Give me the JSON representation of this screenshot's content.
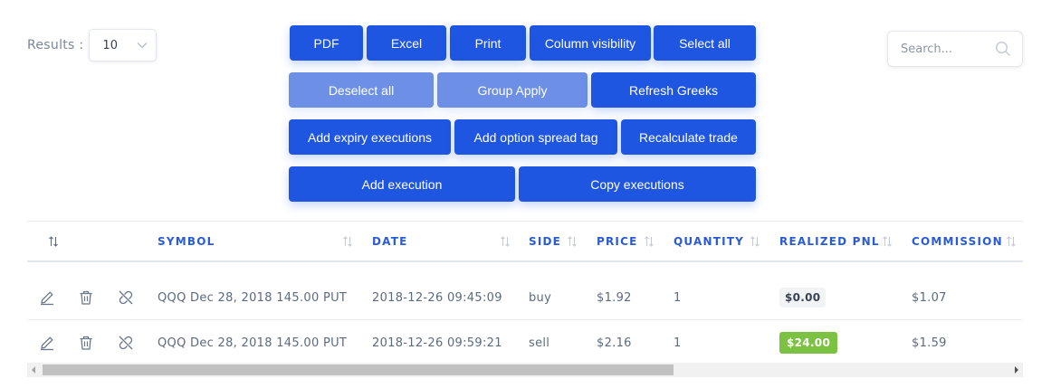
{
  "results": {
    "label": "Results :",
    "value": "10"
  },
  "search": {
    "placeholder": "Search..."
  },
  "buttons": {
    "pdf": "PDF",
    "excel": "Excel",
    "print": "Print",
    "column_visibility": "Column visibility",
    "select_all": "Select all",
    "deselect_all": "Deselect all",
    "group_apply": "Group Apply",
    "refresh_greeks": "Refresh Greeks",
    "add_expiry_executions": "Add expiry executions",
    "add_option_spread_tag": "Add option spread tag",
    "recalculate_trade": "Recalculate trade",
    "add_execution": "Add execution",
    "copy_executions": "Copy executions"
  },
  "table": {
    "headers": [
      "SYMBOL",
      "DATE",
      "SIDE",
      "PRICE",
      "QUANTITY",
      "REALIZED PNL",
      "COMMISSION"
    ],
    "rows": [
      {
        "symbol": "QQQ Dec 28, 2018 145.00 PUT",
        "date": "2018-12-26 09:45:09",
        "side": "buy",
        "price": "$1.92",
        "quantity": "1",
        "pnl": "$0.00",
        "pnl_status": "neutral",
        "commission": "$1.07"
      },
      {
        "symbol": "QQQ Dec 28, 2018 145.00 PUT",
        "date": "2018-12-26 09:59:21",
        "side": "sell",
        "price": "$2.16",
        "quantity": "1",
        "pnl": "$24.00",
        "pnl_status": "positive",
        "commission": "$1.59"
      }
    ]
  },
  "colors": {
    "primary": "#1f56e1",
    "primary_light": "#6d8fe6",
    "header_text": "#2a5bd7",
    "positive_badge": "#7cc242",
    "neutral_badge": "#f2f3f5"
  },
  "icons": {
    "row_actions": [
      "pencil-icon",
      "trash-icon",
      "unlink-icon"
    ],
    "sort": "sort-arrows-icon",
    "search": "search-icon",
    "dropdown": "chevron-down-icon"
  }
}
